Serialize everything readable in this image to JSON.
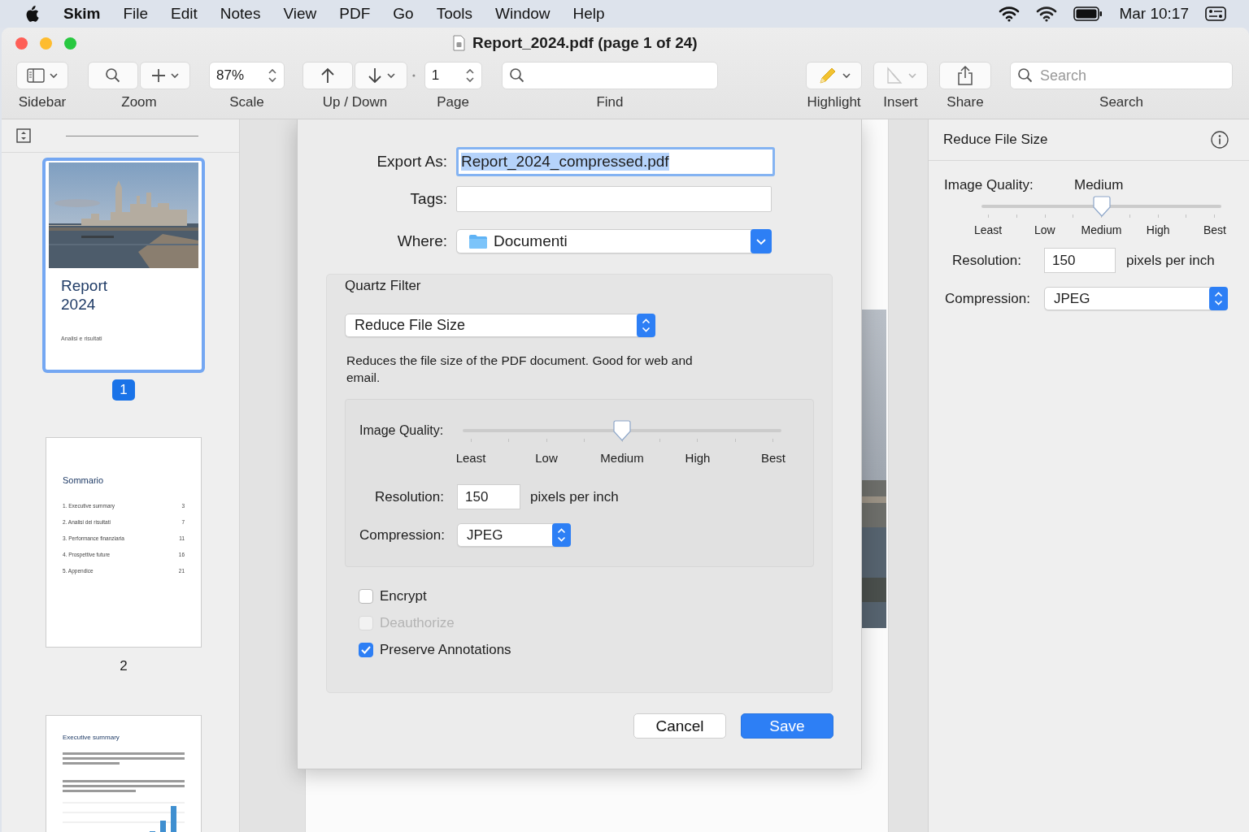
{
  "menu_bar": {
    "app_name": "Skim",
    "menus": [
      "File",
      "Edit",
      "Notes",
      "View",
      "PDF",
      "Go",
      "Tools",
      "Window",
      "Help"
    ],
    "clock": "Mar 10:17"
  },
  "window": {
    "title": "Report_2024.pdf (page 1 of 24)"
  },
  "toolbar": [
    {
      "kind": "sidebar",
      "label": "Sidebar",
      "disabled": false
    },
    {
      "kind": "zoom",
      "label": "Zoom",
      "disabled": false
    },
    {
      "kind": "scale",
      "label": "Scale",
      "value": "87%",
      "disabled": false
    },
    {
      "kind": "updown",
      "label": "Up / Down",
      "disabled": false
    },
    {
      "kind": "page",
      "label": "Page",
      "value": "1",
      "disabled": false
    },
    {
      "kind": "find",
      "label": "Find",
      "disabled": false
    },
    {
      "kind": "highlight",
      "label": "Highlight",
      "disabled": false
    },
    {
      "kind": "insert",
      "label": "Insert",
      "disabled": true
    },
    {
      "kind": "share",
      "label": "Share",
      "disabled": false
    },
    {
      "kind": "search",
      "label": "Search",
      "placeholder": "Search",
      "disabled": false
    }
  ],
  "sidebar": {
    "thumbnails": [
      {
        "kind": "cover",
        "title": "Report 2024",
        "subtitle": "Analisi e risultati",
        "page_label": "1",
        "selected": true
      },
      {
        "kind": "contents",
        "title": "Sommario",
        "entries": [
          {
            "title": "1.  Executive summary",
            "page": "3"
          },
          {
            "title": "2.  Analisi dei risultati",
            "page": "7"
          },
          {
            "title": "3.  Performance finanziaria",
            "page": "11"
          },
          {
            "title": "4.  Prospettive future",
            "page": "16"
          },
          {
            "title": "5.  Appendice",
            "page": "21"
          }
        ],
        "page_label": "2",
        "selected": false
      },
      {
        "kind": "summary",
        "title": "Executive summary",
        "selected": false
      }
    ]
  },
  "dialog": {
    "export_as": {
      "label": "Export As:",
      "value": "Report_2024_compressed.pdf",
      "focused": true
    },
    "tags": {
      "label": "Tags:"
    },
    "where": {
      "label": "Where:",
      "value": "Documenti"
    },
    "quartz_filter": {
      "title": "Quartz Filter",
      "value": "Reduce File Size",
      "description": "Reduces the file size of the PDF document. Good for web and email."
    },
    "image_quality": {
      "label": "Image Quality:",
      "level": 0.5,
      "ticks": [
        "Least",
        "Low",
        "Medium",
        "High",
        "Best"
      ]
    },
    "resolution": {
      "label": "Resolution:",
      "value": "150",
      "unit": "pixels per inch"
    },
    "compression": {
      "label": "Compression:",
      "value": "JPEG"
    },
    "options": [
      {
        "label": "Encrypt",
        "checked": false,
        "disabled": false
      },
      {
        "label": "Deauthorize",
        "checked": false,
        "disabled": true
      },
      {
        "label": "Preserve Annotations",
        "checked": true,
        "disabled": false
      }
    ],
    "buttons": [
      {
        "label": "Cancel",
        "kind": "secondary"
      },
      {
        "label": "Save",
        "kind": "primary"
      }
    ]
  },
  "inspector": {
    "title": "Reduce File Size",
    "image_quality": {
      "label": "Image Quality:",
      "value": "Medium",
      "level": 0.5,
      "ticks": [
        "Least",
        "Low",
        "Medium",
        "High",
        "Best"
      ]
    },
    "resolution": {
      "label": "Resolution:",
      "value": "150",
      "unit": "pixels per inch"
    },
    "compression": {
      "label": "Compression:",
      "value": "JPEG"
    }
  }
}
